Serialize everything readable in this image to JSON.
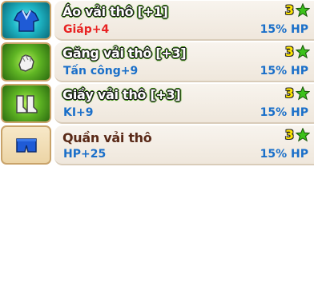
{
  "items": [
    {
      "name": "Áo vải thô [+1]",
      "stat": "Giáp+4",
      "stat_color": "red",
      "hp": "15% HP",
      "level": "3",
      "icon": "shirt-icon",
      "icon_bg": "teal",
      "name_style": "glow"
    },
    {
      "name": "Găng vải thô [+3]",
      "stat": "Tấn công+9",
      "stat_color": "blue",
      "hp": "15% HP",
      "level": "3",
      "icon": "glove-icon",
      "icon_bg": "green",
      "name_style": "glow"
    },
    {
      "name": "Giầy vải thô [+3]",
      "stat": "KI+9",
      "stat_color": "blue",
      "hp": "15% HP",
      "level": "3",
      "icon": "boots-icon",
      "icon_bg": "green",
      "name_style": "glow"
    },
    {
      "name": "Quần vải thô",
      "stat": "HP+25",
      "stat_color": "blue",
      "hp": "15% HP",
      "level": "3",
      "icon": "pants-icon",
      "icon_bg": "plain",
      "name_style": "plain"
    }
  ],
  "colors": {
    "stat_red": "#e82222",
    "stat_blue": "#1a6fc9",
    "level_yellow": "#ffe600",
    "star_green": "#3cc21a"
  }
}
